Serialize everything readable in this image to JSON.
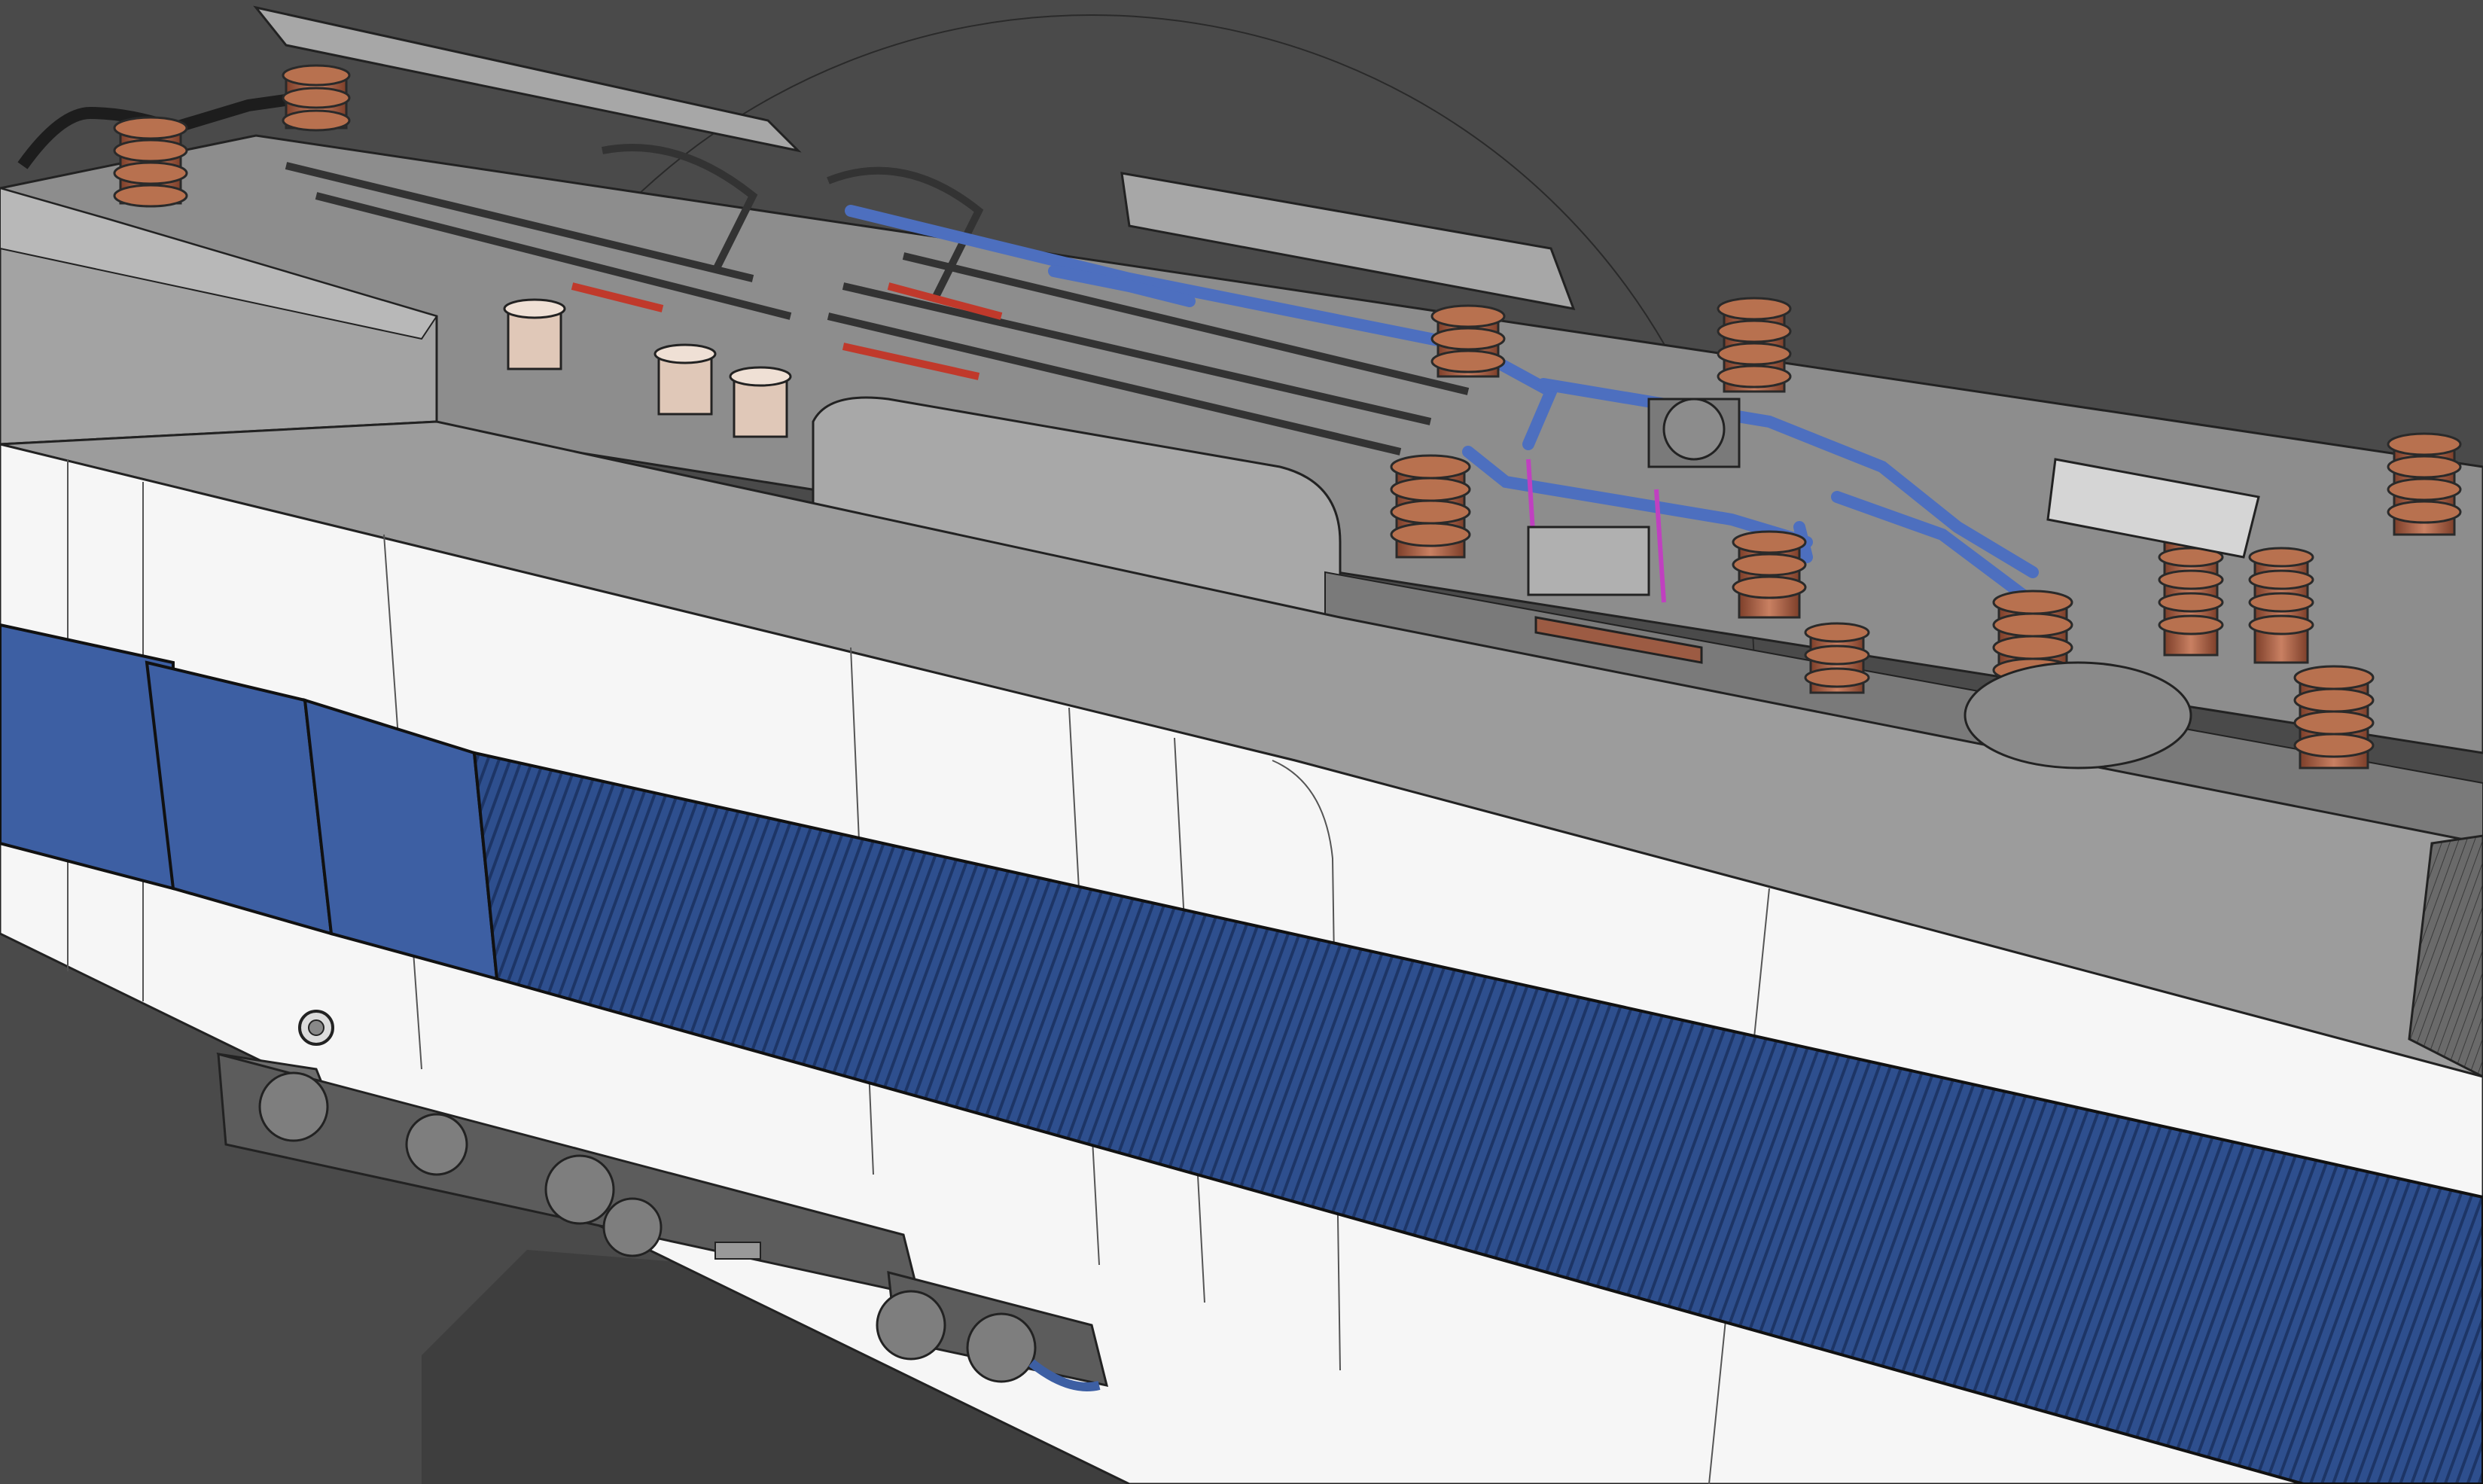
{
  "scene": {
    "description_visible_text": [],
    "colors": {
      "background": "#4a4a4a",
      "body_white": "#f7f7f7",
      "roof_gray": "#9a9a9a",
      "roof_dark": "#7c7c7c",
      "stripe_blue": "#3a5a9a",
      "window_blue": "#3d5fa3",
      "grille_blue": "#2e4f8e",
      "insulator_brown": "#a8644a",
      "pipe_blue": "#4d6fbf",
      "accent_red": "#c0392b",
      "accent_magenta": "#c040c0",
      "line": "#222222"
    }
  }
}
